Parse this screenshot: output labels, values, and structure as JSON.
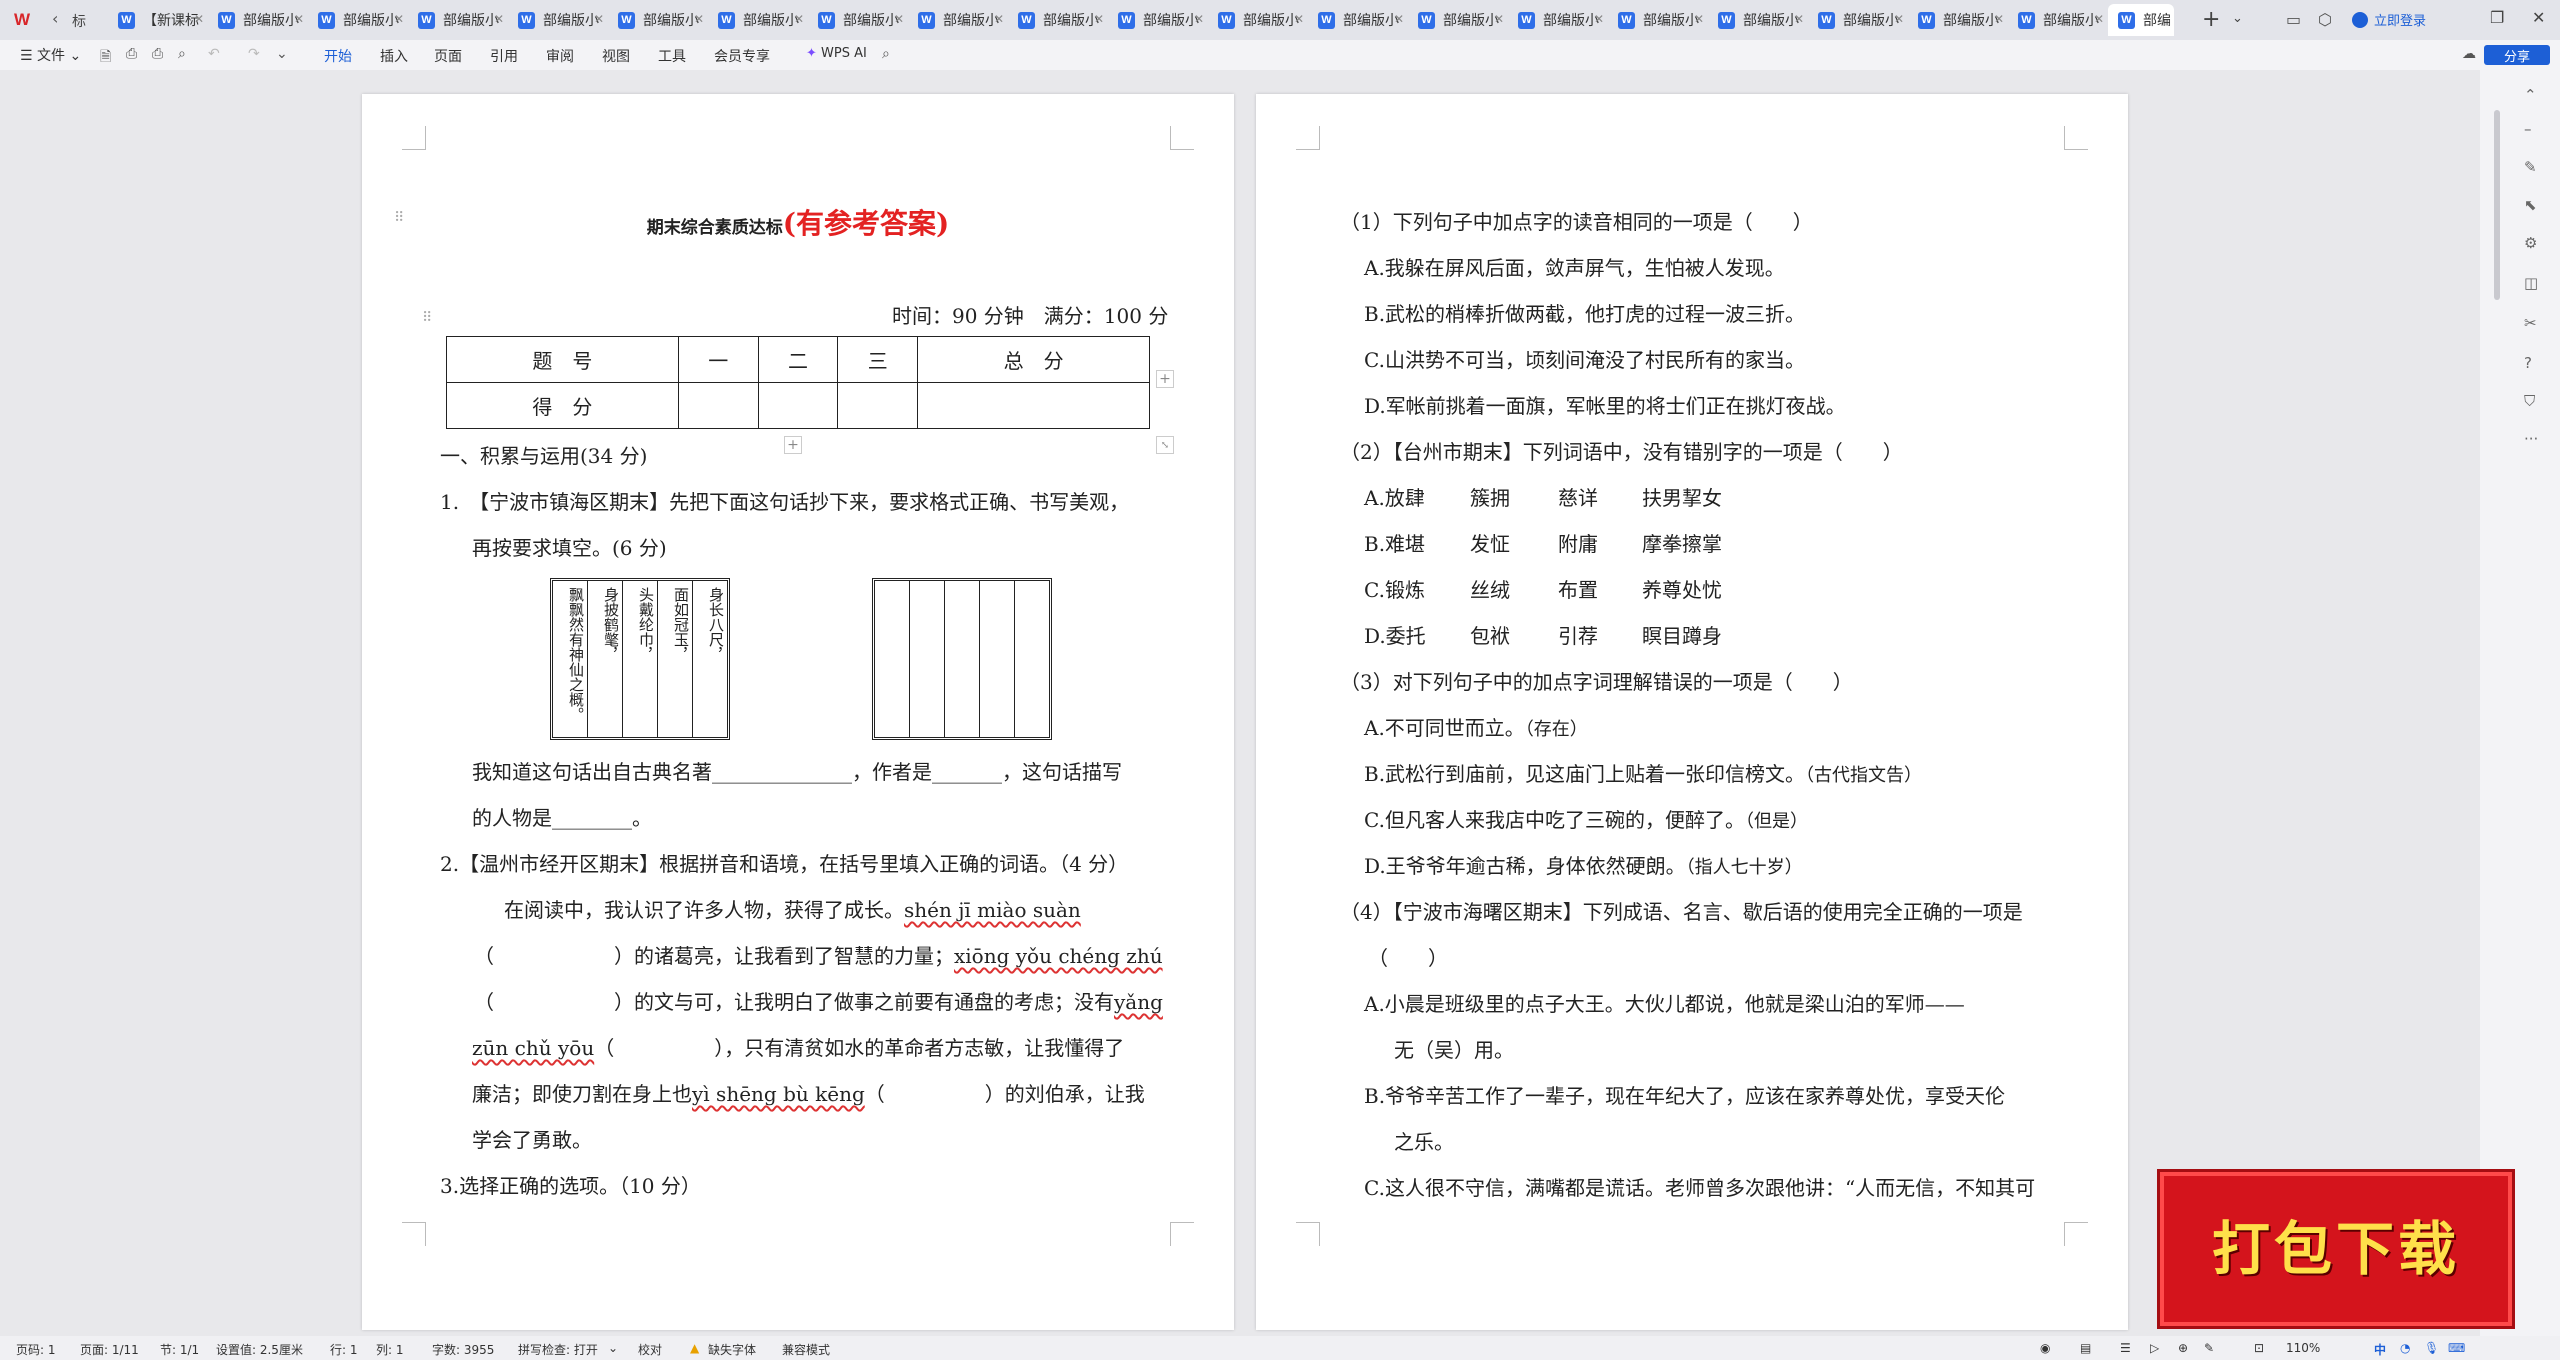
{
  "tabbar": {
    "first_tab_label": "标",
    "tabs": [
      {
        "label": "【新课标",
        "icon": "W"
      },
      {
        "label": "部编版小",
        "icon": "W"
      },
      {
        "label": "部编版小",
        "icon": "W"
      },
      {
        "label": "部编版小",
        "icon": "W"
      },
      {
        "label": "部编版小",
        "icon": "W"
      },
      {
        "label": "部编版小",
        "icon": "W"
      },
      {
        "label": "部编版小",
        "icon": "W"
      },
      {
        "label": "部编版小",
        "icon": "W"
      },
      {
        "label": "部编版小",
        "icon": "W"
      },
      {
        "label": "部编版小",
        "icon": "W"
      },
      {
        "label": "部编版小",
        "icon": "W"
      },
      {
        "label": "部编版小",
        "icon": "W"
      },
      {
        "label": "部编版小",
        "icon": "W"
      },
      {
        "label": "部编版小",
        "icon": "W"
      },
      {
        "label": "部编版小",
        "icon": "W"
      },
      {
        "label": "部编版小",
        "icon": "W"
      },
      {
        "label": "部编版小",
        "icon": "W"
      },
      {
        "label": "部编版小",
        "icon": "W"
      },
      {
        "label": "部编版小",
        "icon": "W"
      },
      {
        "label": "部编版小",
        "icon": "W"
      }
    ],
    "active_tab": {
      "label": "部编",
      "icon": "W"
    },
    "login_label": "立即登录",
    "new_tab": "+",
    "tab_list": "⌄"
  },
  "ribbon": {
    "file_menu": "文件",
    "tabs": [
      "开始",
      "插入",
      "页面",
      "引用",
      "审阅",
      "视图",
      "工具",
      "会员专享"
    ],
    "active_tab": "开始",
    "wps_ai": "WPS AI",
    "share": "分享"
  },
  "doc": {
    "left": {
      "title_main": "期末综合素质达标",
      "title_answer": "(有参考答案)",
      "time_line": "时间：90 分钟　满分：100 分",
      "score_table": {
        "header": [
          "题　号",
          "一",
          "二",
          "三",
          "总　分"
        ],
        "row": [
          "得　分",
          "",
          "",
          "",
          ""
        ]
      },
      "section1": "一、积累与运用(34 分)",
      "q1_line1": "1.　【宁波市镇海区期末】先把下面这句话抄下来，要求格式正确、书写美观，",
      "q1_line2": "再按要求填空。(6 分)",
      "calligraphy_cols": [
        "身长八尺，",
        "面如冠玉，",
        "头戴纶巾，",
        "身披鹤氅，",
        "飘飘然有神仙之概。"
      ],
      "q1_fill1": "我知道这句话出自古典名著______________，作者是_______，这句话描写",
      "q1_fill2": "的人物是________。",
      "q2_line1": "2.【温州市经开区期末】根据拼音和语境，在括号里填入正确的词语。（4 分）",
      "q2_line2_pre": "在阅读中，我认识了许多人物，获得了成长。",
      "pinyin1": "shén jī miào suàn",
      "q2_line3_pre": "（　　　　　　）的诸葛亮，让我看到了智慧的力量；",
      "pinyin2": "xiōng yǒu chéng zhú",
      "q2_line4_pre": "（　　　　　　）的文与可，让我明白了做事之前要有通盘的考虑；没有",
      "pinyin3a": "yǎng",
      "pinyin3b": "zūn chǔ yōu",
      "q2_line5_post": "（　　　　　），只有清贫如水的革命者方志敏，让我懂得了",
      "q2_line6_pre": "廉洁；即使刀割在身上也",
      "pinyin4": "yì shēng bù kēng",
      "q2_line6_post": "（　　　　　）的刘伯承，让我",
      "q2_line7": "学会了勇敢。",
      "q3": "3.选择正确的选项。（10 分）"
    },
    "right": {
      "r1_q": "（1）下列句子中加点字的读音相同的一项是（　　）",
      "r1_a": "A.我躲在屏风后面，敛声屏气，生怕被人发现。",
      "r1_b": "B.武松的梢棒折做两截，他打虎的过程一波三折。",
      "r1_c": "C.山洪势不可当，顷刻间淹没了村民所有的家当。",
      "r1_d": "D.军帐前挑着一面旗，军帐里的将士们正在挑灯夜战。",
      "r2_q": "（2）【台州市期末】下列词语中，没有错别字的一项是（　　）",
      "r2_opts": [
        [
          "A.放肆",
          "簇拥",
          "慈详",
          "扶男挈女"
        ],
        [
          "B.难堪",
          "发怔",
          "附庸",
          "摩拳擦掌"
        ],
        [
          "C.锻炼",
          "丝绒",
          "布置",
          "养尊处忧"
        ],
        [
          "D.委托",
          "包袱",
          "引荐",
          "瞑目蹲身"
        ]
      ],
      "r3_q": "（3）对下列句子中的加点字词理解错误的一项是（　　）",
      "r3_a": "A.不可同世而立。",
      "r3_a_note": "（存在）",
      "r3_b": "B.武松行到庙前，见这庙门上贴着一张印信榜文。",
      "r3_b_note": "（古代指文告）",
      "r3_c": "C.但凡客人来我店中吃了三碗的，便醉了。",
      "r3_c_note": "（但是）",
      "r3_d": "D.王爷爷年逾古稀，身体依然硬朗。",
      "r3_d_note": "（指人七十岁）",
      "r4_q1": "（4）【宁波市海曙区期末】下列成语、名言、歇后语的使用完全正确的一项是",
      "r4_q2": "（　　）",
      "r4_a1": "A.小晨是班级里的点子大王。大伙儿都说，他就是梁山泊的军师——",
      "r4_a2": "无（吴）用。",
      "r4_b1": "B.爷爷辛苦工作了一辈子，现在年纪大了，应该在家养尊处优，享受天伦",
      "r4_b2": "之乐。",
      "r4_c1": "C.这人很不守信，满嘴都是谎话。老师曾多次跟他讲：“人而无信，不知其可"
    }
  },
  "promo": {
    "text": "打包下载"
  },
  "statusbar": {
    "page_code": "页码: 1",
    "page_count": "页面: 1/11",
    "section": "节: 1/1",
    "setting": "设置值: 2.5厘米",
    "row": "行: 1",
    "col": "列: 1",
    "words": "字数: 3955",
    "spell": "拼写检查: 打开",
    "proof": "校对",
    "missing_font": "缺失字体",
    "compat": "兼容模式",
    "zoom": "110%",
    "ime": "中"
  }
}
